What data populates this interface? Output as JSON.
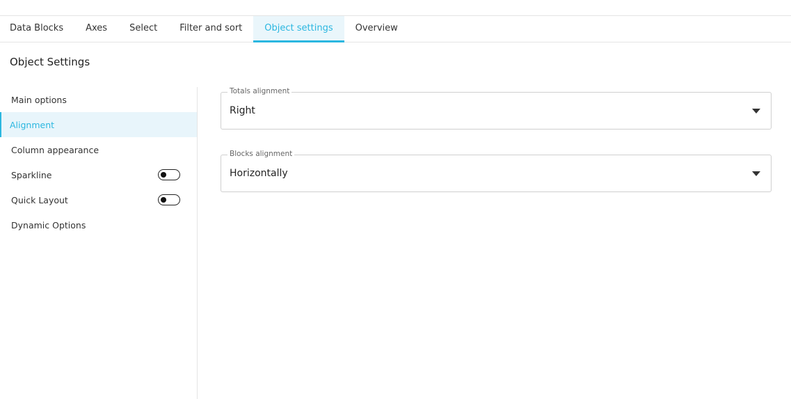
{
  "tabs": [
    {
      "label": "Data Blocks"
    },
    {
      "label": "Axes"
    },
    {
      "label": "Select"
    },
    {
      "label": "Filter and sort"
    },
    {
      "label": "Object settings",
      "active": true
    },
    {
      "label": "Overview"
    }
  ],
  "page_title": "Object Settings",
  "sidebar": {
    "items": [
      {
        "label": "Main options"
      },
      {
        "label": "Alignment",
        "active": true
      },
      {
        "label": "Column appearance"
      },
      {
        "label": "Sparkline",
        "toggle": "off"
      },
      {
        "label": "Quick Layout",
        "toggle": "off"
      },
      {
        "label": "Dynamic Options"
      }
    ]
  },
  "fields": {
    "totals_alignment": {
      "label": "Totals alignment",
      "value": "Right"
    },
    "blocks_alignment": {
      "label": "Blocks alignment",
      "value": "Horizontally"
    }
  },
  "colors": {
    "accent": "#2bb7e0",
    "active_bg": "#e8f5fb"
  }
}
